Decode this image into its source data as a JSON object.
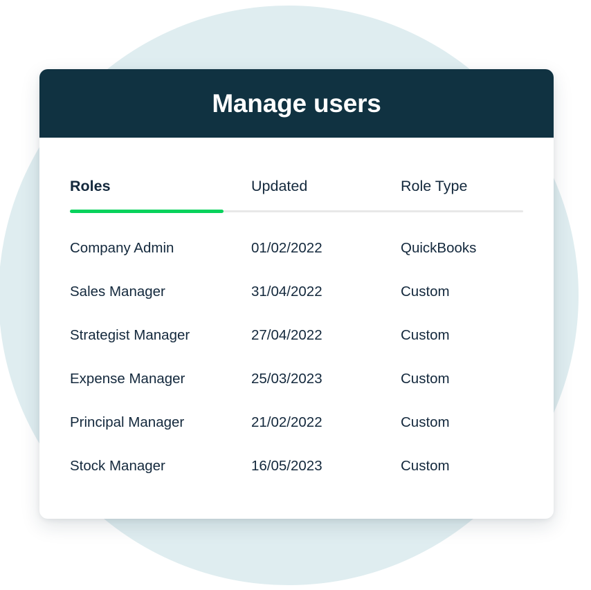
{
  "card": {
    "title": "Manage users"
  },
  "colors": {
    "header_background": "#103241",
    "accent_green": "#07D25C",
    "text_dark": "#13283C",
    "circle_background": "#DFEDF0",
    "card_background": "#FFFFFF",
    "divider_grey": "#E8E8E8"
  },
  "table": {
    "columns": [
      {
        "label": "Roles",
        "bold": true
      },
      {
        "label": "Updated",
        "bold": false
      },
      {
        "label": "Role Type",
        "bold": false
      }
    ],
    "rows": [
      {
        "role": "Company Admin",
        "updated": "01/02/2022",
        "role_type": "QuickBooks"
      },
      {
        "role": "Sales Manager",
        "updated": "31/04/2022",
        "role_type": "Custom"
      },
      {
        "role": "Strategist Manager",
        "updated": "27/04/2022",
        "role_type": "Custom"
      },
      {
        "role": "Expense Manager",
        "updated": "25/03/2023",
        "role_type": "Custom"
      },
      {
        "role": "Principal Manager",
        "updated": "21/02/2022",
        "role_type": "Custom"
      },
      {
        "role": "Stock Manager",
        "updated": "16/05/2023",
        "role_type": "Custom"
      }
    ]
  }
}
